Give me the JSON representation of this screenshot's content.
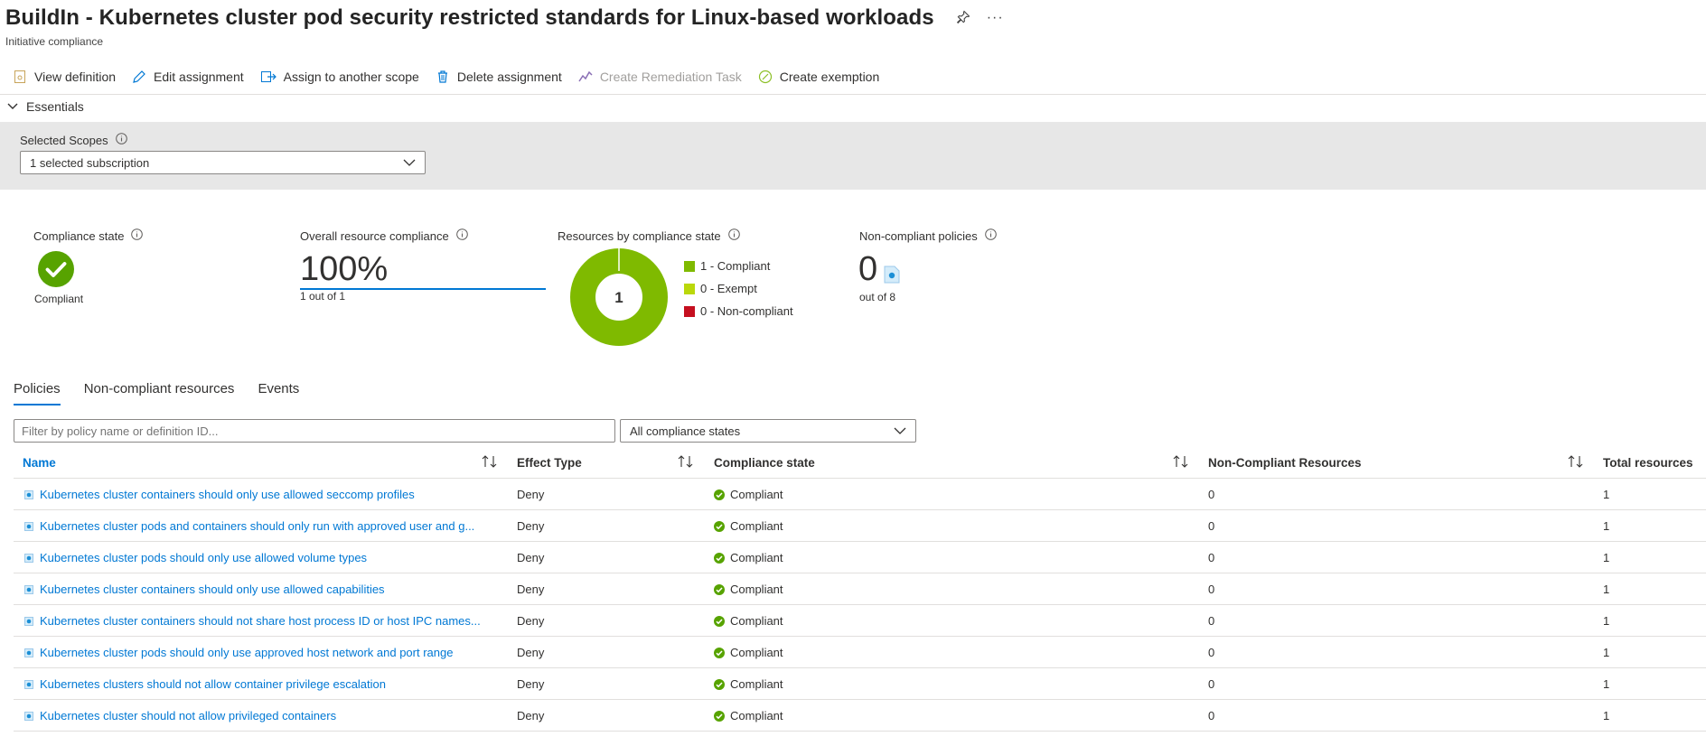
{
  "header": {
    "title": "BuildIn - Kubernetes cluster pod security restricted standards for Linux-based workloads",
    "subtitle": "Initiative compliance"
  },
  "toolbar": {
    "view_definition": "View definition",
    "edit_assignment": "Edit assignment",
    "assign_scope": "Assign to another scope",
    "delete_assignment": "Delete assignment",
    "create_remediation": "Create Remediation Task",
    "create_exemption": "Create exemption"
  },
  "essentials": {
    "label": "Essentials"
  },
  "scopes": {
    "label": "Selected Scopes",
    "value": "1 selected subscription"
  },
  "metrics": {
    "compliance_state_label": "Compliance state",
    "compliance_state_value": "Compliant",
    "overall_label": "Overall resource compliance",
    "overall_value": "100%",
    "overall_sub": "1 out of 1",
    "resources_label": "Resources by compliance state",
    "donut_center": "1",
    "legend": [
      {
        "label": "1 - Compliant",
        "color": "#7fba00"
      },
      {
        "label": "0 - Exempt",
        "color": "#bad80a"
      },
      {
        "label": "0 - Non-compliant",
        "color": "#c50f1f"
      }
    ],
    "ncp_label": "Non-compliant policies",
    "ncp_value": "0",
    "ncp_sub": "out of 8"
  },
  "tabs": [
    "Policies",
    "Non-compliant resources",
    "Events"
  ],
  "filter": {
    "placeholder": "Filter by policy name or definition ID...",
    "state_value": "All compliance states"
  },
  "table": {
    "headers": {
      "name": "Name",
      "effect": "Effect Type",
      "state": "Compliance state",
      "noncompliant": "Non-Compliant Resources",
      "total": "Total resources"
    },
    "rows": [
      {
        "name": "Kubernetes cluster containers should only use allowed seccomp profiles",
        "effect": "Deny",
        "state": "Compliant",
        "noncompliant": "0",
        "total": "1"
      },
      {
        "name": "Kubernetes cluster pods and containers should only run with approved user and g...",
        "effect": "Deny",
        "state": "Compliant",
        "noncompliant": "0",
        "total": "1"
      },
      {
        "name": "Kubernetes cluster pods should only use allowed volume types",
        "effect": "Deny",
        "state": "Compliant",
        "noncompliant": "0",
        "total": "1"
      },
      {
        "name": "Kubernetes cluster containers should only use allowed capabilities",
        "effect": "Deny",
        "state": "Compliant",
        "noncompliant": "0",
        "total": "1"
      },
      {
        "name": "Kubernetes cluster containers should not share host process ID or host IPC names...",
        "effect": "Deny",
        "state": "Compliant",
        "noncompliant": "0",
        "total": "1"
      },
      {
        "name": "Kubernetes cluster pods should only use approved host network and port range",
        "effect": "Deny",
        "state": "Compliant",
        "noncompliant": "0",
        "total": "1"
      },
      {
        "name": "Kubernetes clusters should not allow container privilege escalation",
        "effect": "Deny",
        "state": "Compliant",
        "noncompliant": "0",
        "total": "1"
      },
      {
        "name": "Kubernetes cluster should not allow privileged containers",
        "effect": "Deny",
        "state": "Compliant",
        "noncompliant": "0",
        "total": "1"
      }
    ]
  },
  "colors": {
    "accent": "#0078d4",
    "compliant": "#57a300"
  }
}
